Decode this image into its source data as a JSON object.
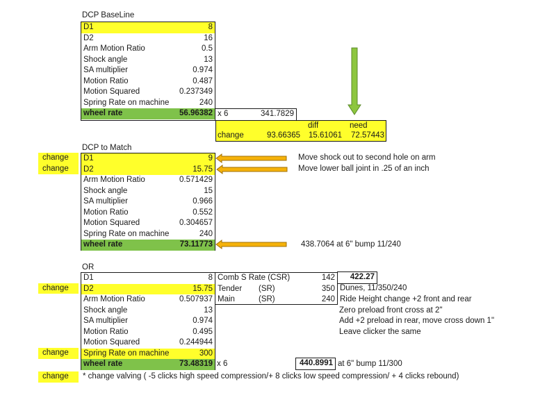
{
  "baseline": {
    "title": "DCP BaseLine",
    "rows": [
      {
        "label": "D1",
        "value": "8"
      },
      {
        "label": "D2",
        "value": "16"
      },
      {
        "label": "Arm Motion Ratio",
        "value": "0.5"
      },
      {
        "label": "Shock angle",
        "value": "13"
      },
      {
        "label": "SA multiplier",
        "value": "0.974"
      },
      {
        "label": "Motion Ratio",
        "value": "0.487"
      },
      {
        "label": "Motion Squared",
        "value": "0.237349"
      },
      {
        "label": "Spring Rate on machine",
        "value": "240"
      },
      {
        "label": "wheel rate",
        "value": "56.96382"
      }
    ],
    "multiplier": "x 6",
    "product": "341.7829",
    "change_box": {
      "diff_label": "diff",
      "need_label": "need",
      "change_label": "change",
      "change_value": "93.66365",
      "diff_value": "15.61061",
      "need_value": "72.57443"
    }
  },
  "match": {
    "title": "DCP to Match",
    "change_tag": "change",
    "rows": [
      {
        "label": "D1",
        "value": "9"
      },
      {
        "label": "D2",
        "value": "15.75"
      },
      {
        "label": "Arm Motion Ratio",
        "value": "0.571429"
      },
      {
        "label": "Shock angle",
        "value": "15"
      },
      {
        "label": "SA multiplier",
        "value": "0.966"
      },
      {
        "label": "Motion Ratio",
        "value": "0.552"
      },
      {
        "label": "Motion Squared",
        "value": "0.304657"
      },
      {
        "label": "Spring Rate on machine",
        "value": "240"
      },
      {
        "label": "wheel rate",
        "value": "73.11773"
      }
    ],
    "notes": {
      "d1": "Move shock out to second hole on arm",
      "d2": "Move lower ball joint in .25 of an inch",
      "wheel_rate": "438.7064 at 6\" bump 11/240"
    }
  },
  "or_section": {
    "title": "OR",
    "change_tag": "change",
    "rows": [
      {
        "label": "D1",
        "value": "8"
      },
      {
        "label": "D2",
        "value": "15.75"
      },
      {
        "label": "Arm Motion Ratio",
        "value": "0.507937"
      },
      {
        "label": "Shock angle",
        "value": "13"
      },
      {
        "label": "SA multiplier",
        "value": "0.974"
      },
      {
        "label": "Motion Ratio",
        "value": "0.495"
      },
      {
        "label": "Motion Squared",
        "value": "0.244944"
      },
      {
        "label": "Spring Rate on machine",
        "value": "300"
      },
      {
        "label": "wheel rate",
        "value": "73.48319"
      }
    ],
    "springs": [
      {
        "label": "Comb S Rate (CSR)",
        "tag": "",
        "value": "142"
      },
      {
        "label": "Tender",
        "tag": "(SR)",
        "value": "350"
      },
      {
        "label": "Main",
        "tag": "(SR)",
        "value": "240"
      }
    ],
    "csr_result": "422.27",
    "notes": [
      "Dunes, 11/350/240",
      "Ride Height change +2 front and rear",
      "Zero preload front cross at 2\"",
      "Add +2 preload in rear, move cross down 1\"",
      "Leave clicker the same"
    ],
    "multiplier": "x 6",
    "product": "440.8991",
    "product_note": "at 6\" bump 11/300",
    "valving_note": "* change valving ( -5 clicks high speed compression/+ 8 clicks low speed compression/ + 4 clicks rebound)"
  },
  "colors": {
    "highlight_yellow": "#ffff2b",
    "wheel_rate_green": "#7fc24a",
    "arrow_orange": "#f5b20a",
    "arrow_green": "#8dc63f"
  }
}
